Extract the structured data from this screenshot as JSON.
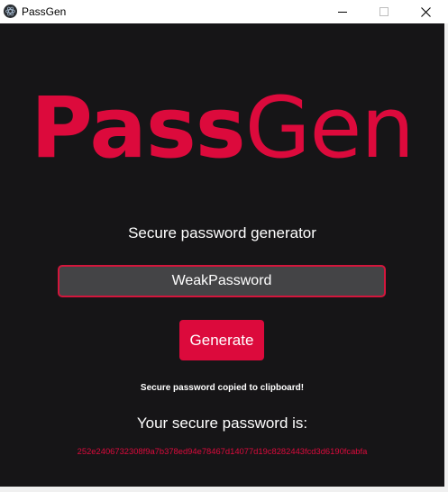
{
  "window": {
    "title": "PassGen",
    "controls": {
      "minimize_icon": "minimize-icon",
      "maximize_icon": "maximize-icon",
      "close_icon": "close-icon"
    }
  },
  "logo": {
    "bold_part": "Pass",
    "light_part": "Gen"
  },
  "subtitle": "Secure password generator",
  "input": {
    "value": "WeakPassword",
    "placeholder": ""
  },
  "generate_button": "Generate",
  "status": "Secure password copied to clipboard!",
  "result": {
    "label": "Your secure password is:",
    "value": "252e2406732308f9a7b378ed94e78467d14077d19c8282443fcd3d6190fcabfa"
  },
  "colors": {
    "accent": "#dc0a3c",
    "background": "#161517",
    "input_background": "#444446",
    "text": "#ffffff"
  }
}
